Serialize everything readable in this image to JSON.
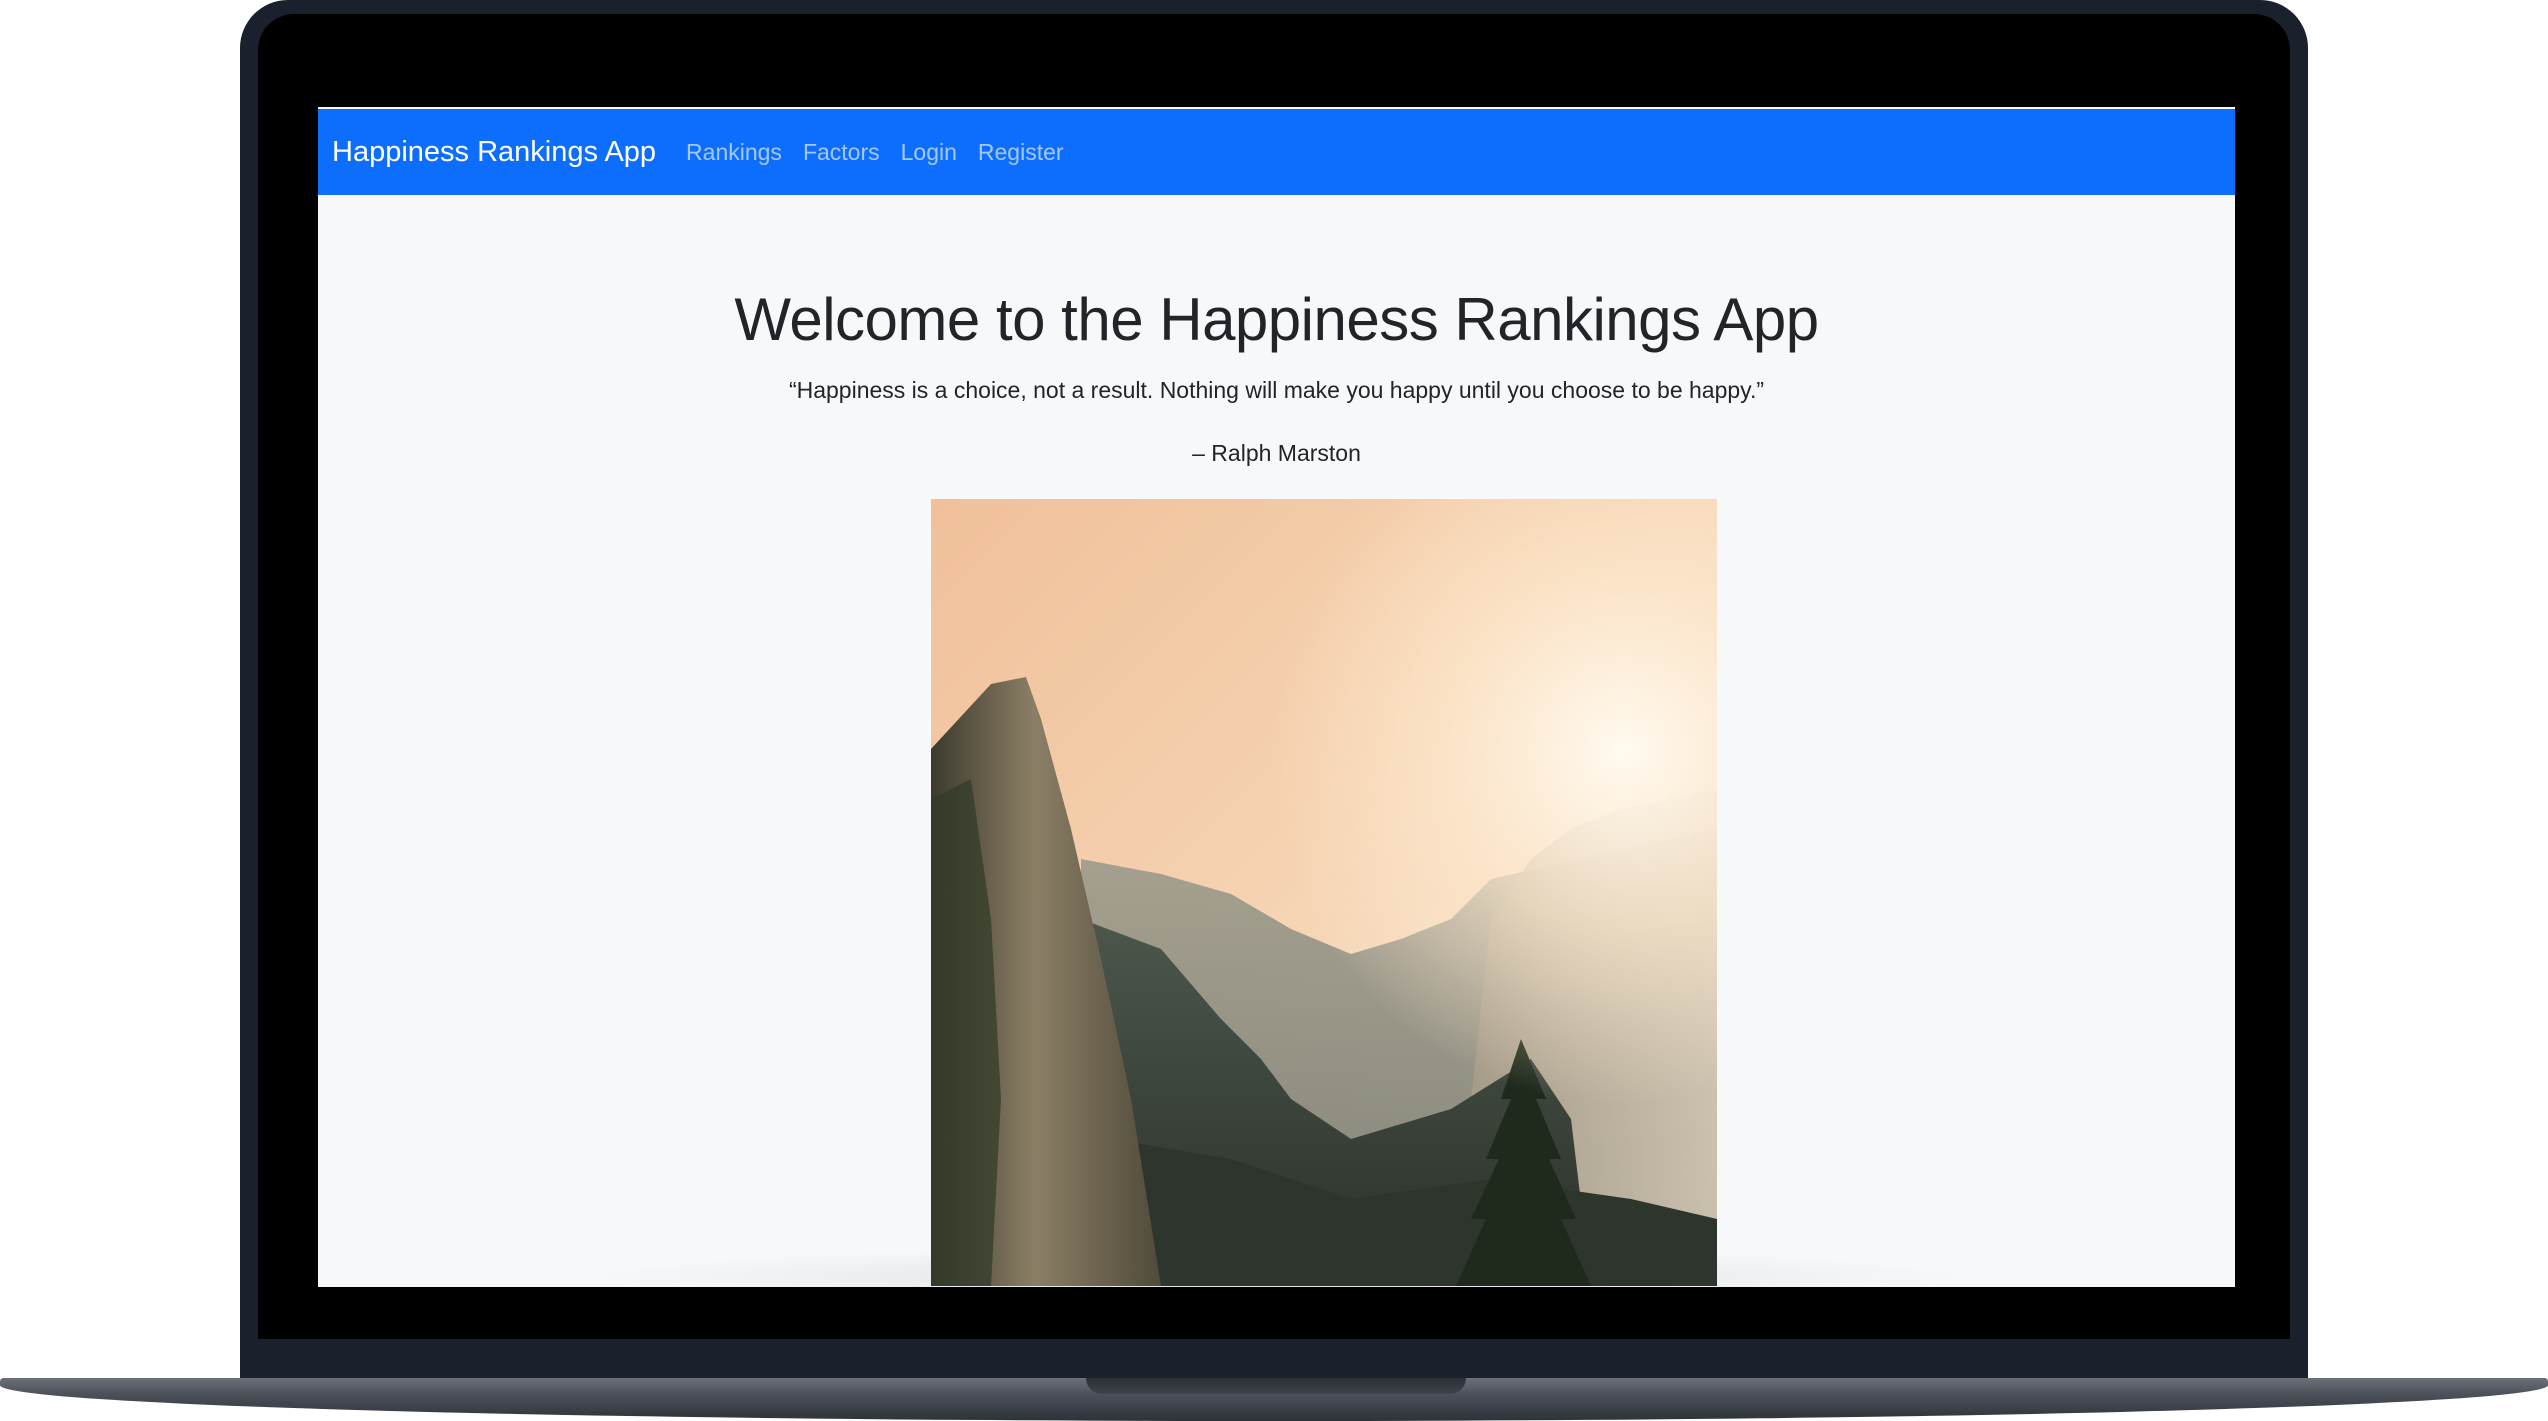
{
  "navbar": {
    "brand": "Happiness Rankings App",
    "links": [
      "Rankings",
      "Factors",
      "Login",
      "Register"
    ]
  },
  "hero": {
    "title": "Welcome to the Happiness Rankings App",
    "quote": "“Happiness is a choice, not a result. Nothing will make you happy until you choose to be happy.”",
    "author": "– Ralph Marston"
  },
  "colors": {
    "navbar_bg": "#0d6efd",
    "page_bg": "#f7f8fa",
    "text": "#212529",
    "bezel": "#1a202c"
  }
}
